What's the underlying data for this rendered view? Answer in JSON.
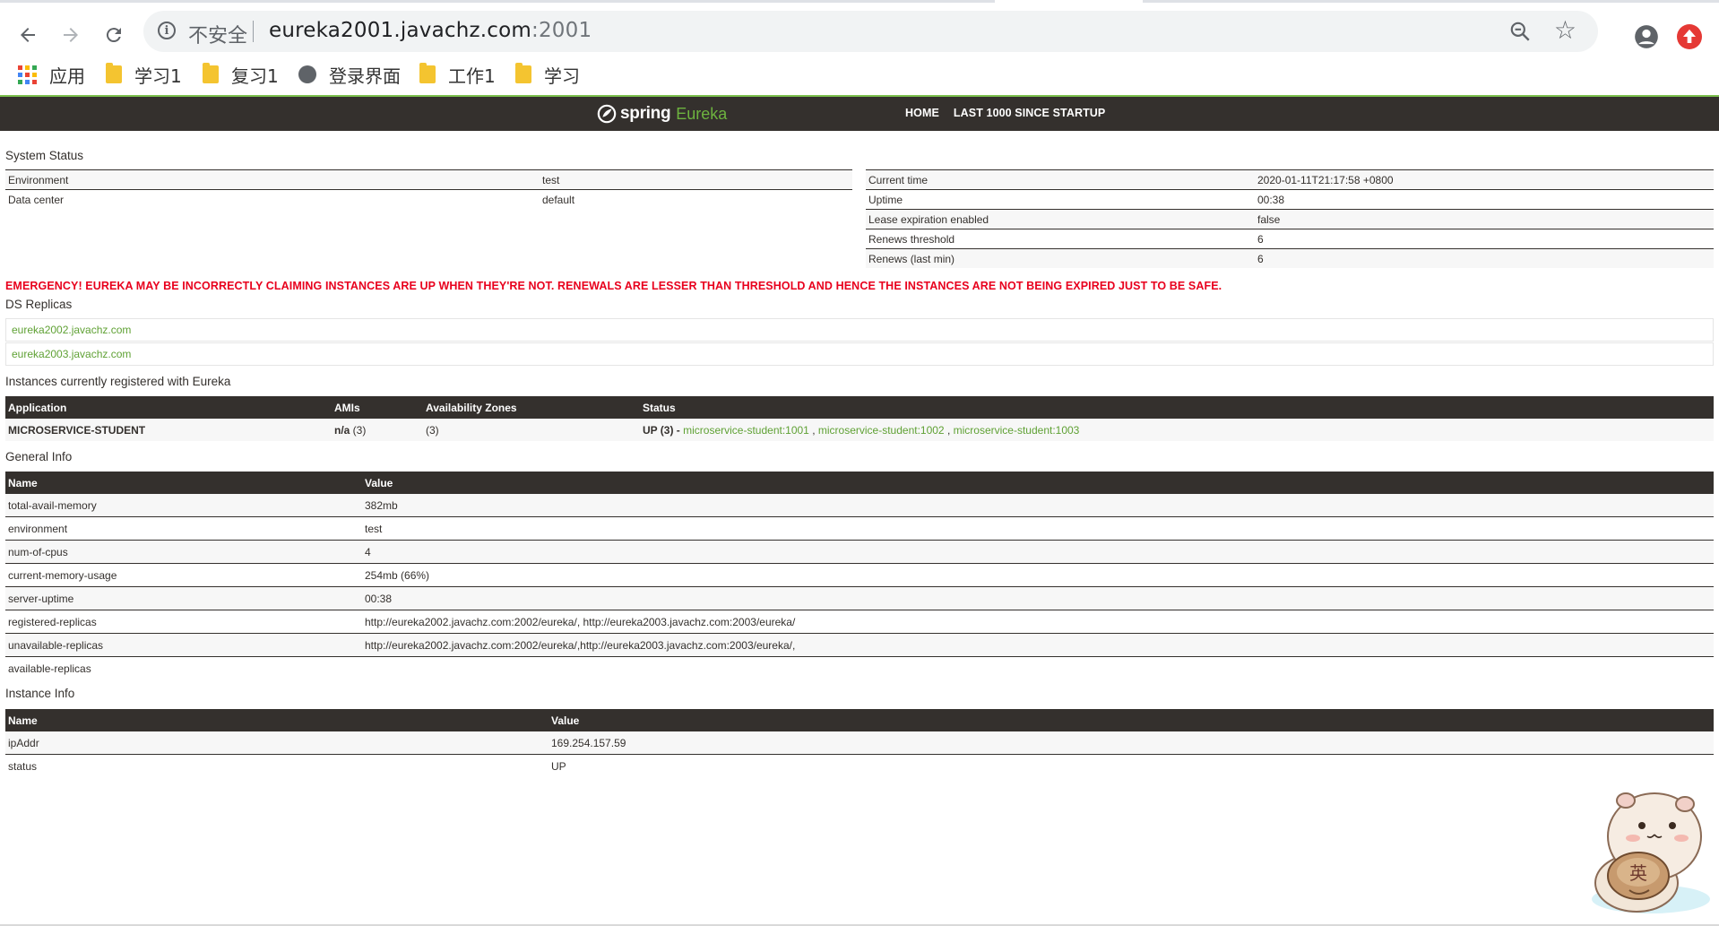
{
  "browser": {
    "security_label": "不安全",
    "url_host": "eureka2001.javachz.com",
    "url_port": ":2001",
    "bookmarks": [
      {
        "label": "应用",
        "type": "apps"
      },
      {
        "label": "学习1",
        "type": "folder"
      },
      {
        "label": "复习1",
        "type": "folder"
      },
      {
        "label": "登录界面",
        "type": "site"
      },
      {
        "label": "工作1",
        "type": "folder"
      },
      {
        "label": "学习",
        "type": "folder"
      }
    ]
  },
  "navbar": {
    "brand_spring": "spring",
    "brand_eureka": "Eureka",
    "links": [
      "HOME",
      "LAST 1000 SINCE STARTUP"
    ],
    "bg_color": "#34302d",
    "accent_color": "#6db33f"
  },
  "system_status": {
    "title": "System Status",
    "left": [
      {
        "label": "Environment",
        "value": "test"
      },
      {
        "label": "Data center",
        "value": "default"
      }
    ],
    "right": [
      {
        "label": "Current time",
        "value": "2020-01-11T21:17:58 +0800"
      },
      {
        "label": "Uptime",
        "value": "00:38"
      },
      {
        "label": "Lease expiration enabled",
        "value": "false"
      },
      {
        "label": "Renews threshold",
        "value": "6"
      },
      {
        "label": "Renews (last min)",
        "value": "6"
      }
    ]
  },
  "emergency": "EMERGENCY! EUREKA MAY BE INCORRECTLY CLAIMING INSTANCES ARE UP WHEN THEY'RE NOT. RENEWALS ARE LESSER THAN THRESHOLD AND HENCE THE INSTANCES ARE NOT BEING EXPIRED JUST TO BE SAFE.",
  "ds_replicas": {
    "title": "DS Replicas",
    "items": [
      "eureka2002.javachz.com",
      "eureka2003.javachz.com"
    ]
  },
  "instances": {
    "title": "Instances currently registered with Eureka",
    "headers": [
      "Application",
      "AMIs",
      "Availability Zones",
      "Status"
    ],
    "rows": [
      {
        "application": "MICROSERVICE-STUDENT",
        "amis_prefix": "n/a",
        "amis_count": " (3)",
        "zones": "(3)",
        "status_prefix": "UP (3) - ",
        "links": [
          "microservice-student:1001",
          "microservice-student:1002",
          "microservice-student:1003"
        ],
        "link_sep": " , "
      }
    ]
  },
  "general_info": {
    "title": "General Info",
    "headers": [
      "Name",
      "Value"
    ],
    "rows": [
      {
        "name": "total-avail-memory",
        "value": "382mb"
      },
      {
        "name": "environment",
        "value": "test"
      },
      {
        "name": "num-of-cpus",
        "value": "4"
      },
      {
        "name": "current-memory-usage",
        "value": "254mb (66%)"
      },
      {
        "name": "server-uptime",
        "value": "00:38"
      },
      {
        "name": "registered-replicas",
        "value": "http://eureka2002.javachz.com:2002/eureka/, http://eureka2003.javachz.com:2003/eureka/"
      },
      {
        "name": "unavailable-replicas",
        "value": "http://eureka2002.javachz.com:2002/eureka/,http://eureka2003.javachz.com:2003/eureka/,"
      },
      {
        "name": "available-replicas",
        "value": ""
      }
    ]
  },
  "instance_info": {
    "title": "Instance Info",
    "headers": [
      "Name",
      "Value"
    ],
    "rows": [
      {
        "name": "ipAddr",
        "value": "169.254.157.59"
      },
      {
        "name": "status",
        "value": "UP"
      }
    ]
  },
  "hamster_sticker_text": "英"
}
